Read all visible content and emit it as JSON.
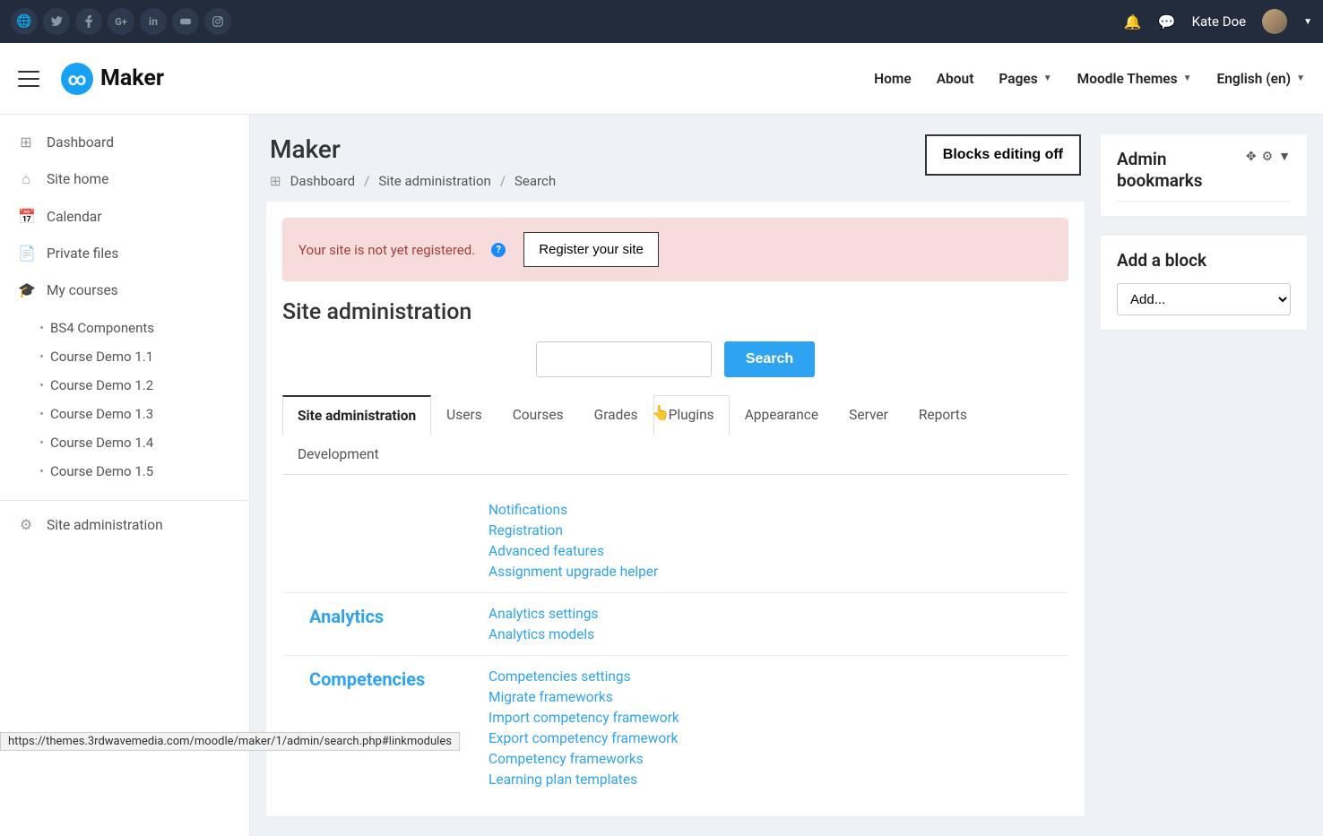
{
  "topbar": {
    "social": [
      "globe-icon",
      "twitter-icon",
      "facebook-icon",
      "gplus-icon",
      "linkedin-icon",
      "youtube-icon",
      "instagram-icon"
    ],
    "user_name": "Kate Doe"
  },
  "navbar": {
    "brand": "Maker",
    "items": [
      {
        "label": "Home",
        "caret": false
      },
      {
        "label": "About",
        "caret": false
      },
      {
        "label": "Pages",
        "caret": true
      },
      {
        "label": "Moodle Themes",
        "caret": true
      },
      {
        "label": "English (en)",
        "caret": true
      }
    ]
  },
  "sidebar": {
    "items": [
      {
        "icon": "dashboard",
        "label": "Dashboard"
      },
      {
        "icon": "home",
        "label": "Site home"
      },
      {
        "icon": "calendar",
        "label": "Calendar"
      },
      {
        "icon": "file",
        "label": "Private files"
      },
      {
        "icon": "grad",
        "label": "My courses"
      }
    ],
    "courses": [
      "BS4 Components",
      "Course Demo 1.1",
      "Course Demo 1.2",
      "Course Demo 1.3",
      "Course Demo 1.4",
      "Course Demo 1.5"
    ],
    "admin_label": "Site administration"
  },
  "page": {
    "title": "Maker",
    "breadcrumb": [
      "Dashboard",
      "Site administration",
      "Search"
    ],
    "blocks_btn": "Blocks editing off"
  },
  "alert": {
    "text": "Your site is not yet registered.",
    "btn": "Register your site"
  },
  "admin": {
    "title": "Site administration",
    "search_btn": "Search",
    "tabs": [
      "Site administration",
      "Users",
      "Courses",
      "Grades",
      "Plugins",
      "Appearance",
      "Server",
      "Reports",
      "Development"
    ],
    "active_tab": 0,
    "hover_tab": 4,
    "sections": [
      {
        "title": "",
        "links": [
          "Notifications",
          "Registration",
          "Advanced features",
          "Assignment upgrade helper"
        ]
      },
      {
        "title": "Analytics",
        "links": [
          "Analytics settings",
          "Analytics models"
        ]
      },
      {
        "title": "Competencies",
        "links": [
          "Competencies settings",
          "Migrate frameworks",
          "Import competency framework",
          "Export competency framework",
          "Competency frameworks",
          "Learning plan templates"
        ]
      }
    ]
  },
  "right": {
    "bookmarks_title": "Admin bookmarks",
    "addblock_title": "Add a block",
    "addblock_placeholder": "Add..."
  },
  "status_url": "https://themes.3rdwavemedia.com/moodle/maker/1/admin/search.php#linkmodules"
}
